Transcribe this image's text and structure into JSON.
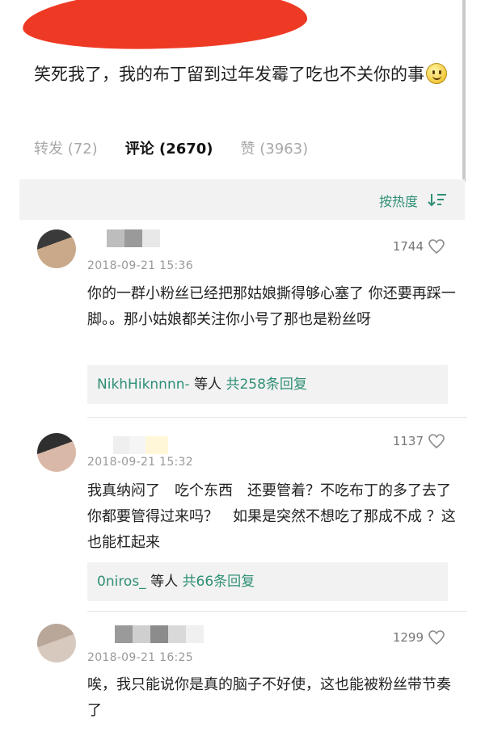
{
  "post": {
    "text": "笑死我了，我的布丁留到过年发霉了吃也不关你的事",
    "emoji_icon": "smiley-emoji-icon"
  },
  "tabs": [
    {
      "label": "转发",
      "count": "(72)"
    },
    {
      "label": "评论",
      "count": "(2670)"
    },
    {
      "label": "赞",
      "count": "(3963)"
    }
  ],
  "sort": {
    "label": "按热度",
    "icon": "sort-icon"
  },
  "colors": {
    "accent": "#2f8f76",
    "redaction": "#ee3a24",
    "panel": "#f2f2f2"
  },
  "comments": [
    {
      "likes": "1744",
      "timestamp": "2018-09-21 15:36",
      "text": "你的一群小粉丝已经把那姑娘撕得够心塞了 你还要再踩一脚。。那小姑娘都关注你小号了那也是粉丝呀",
      "reply_user": "NikhHiknnnn-",
      "reply_mid": " 等人 ",
      "reply_count": "共258条回复"
    },
    {
      "likes": "1137",
      "timestamp": "2018-09-21 15:32",
      "text": "我真纳闷了　吃个东西　还要管着？不吃布丁的多了去了　你都要管得过来吗？　如果是突然不想吃了那成不成 ？这也能杠起来",
      "reply_user": "0niros_",
      "reply_mid": " 等人 ",
      "reply_count": "共66条回复"
    },
    {
      "likes": "1299",
      "timestamp": "2018-09-21 16:25",
      "text": "唉，我只能说你是真的脑子不好使，这也能被粉丝带节奏了"
    }
  ]
}
